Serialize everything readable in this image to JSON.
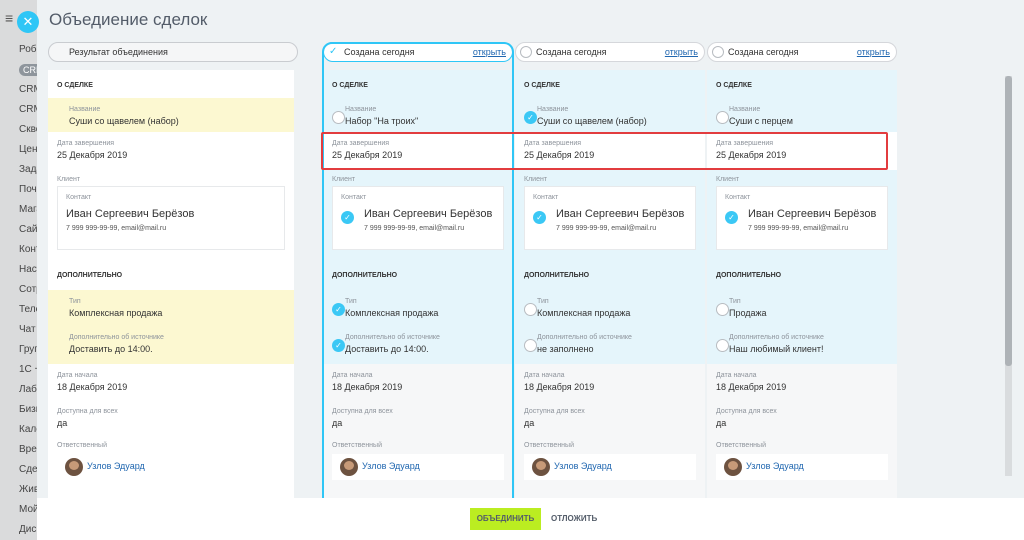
{
  "title": "Объедиение сделок",
  "sidebar": {
    "items": [
      "Робо",
      "CRM",
      "CRM",
      "CRM",
      "Скво",
      "Цен",
      "Зада",
      "Поч",
      "Мага",
      "Сайт",
      "Конт",
      "Наст",
      "Сотр",
      "Теле",
      "Чат",
      "Груп",
      "1С +",
      "Лаба",
      "Бизн",
      "Кале",
      "Врем",
      "Сдел",
      "Живо",
      "Мой",
      "Дисн"
    ]
  },
  "result_header": "Результат объединения",
  "sections": {
    "about": "О СДЕЛКЕ",
    "extra": "ДОПОЛНИТЕЛЬНО"
  },
  "labels": {
    "name": "Название",
    "close_date": "Дата завершения",
    "client": "Клиент",
    "contact": "Контакт",
    "type": "Тип",
    "source_info": "Дополнительно об источнике",
    "start_date": "Дата начала",
    "available": "Доступна для всех",
    "responsible": "Ответственный"
  },
  "result": {
    "name": "Суши со щавелем (набор)",
    "close_date": "25 Декабря 2019",
    "contact_name": "Иван Сергеевич Берёзов",
    "contact_phone": "7 999 999-99-99, email@mail.ru",
    "type": "Комплексная продажа",
    "source_info": "Доставить до 14:00.",
    "start_date": "18 Декабря 2019",
    "available": "да",
    "responsible": "Узлов Эдуард"
  },
  "columns": [
    {
      "header": "Создана сегодня",
      "open_label": "открыть",
      "name": "Набор \"На троих\"",
      "close_date": "25 Декабря 2019",
      "contact_name": "Иван Сергеевич Берёзов",
      "contact_phone": "7 999 999-99-99, email@mail.ru",
      "type": "Комплексная продажа",
      "source_info": "Доставить до 14:00.",
      "start_date": "18 Декабря 2019",
      "available": "да",
      "responsible": "Узлов Эдуард"
    },
    {
      "header": "Создана сегодня",
      "open_label": "открыть",
      "name": "Суши со щавелем (набор)",
      "close_date": "25 Декабря 2019",
      "contact_name": "Иван Сергеевич Берёзов",
      "contact_phone": "7 999 999-99-99, email@mail.ru",
      "type": "Комплексная продажа",
      "source_info": "не заполнено",
      "start_date": "18 Декабря 2019",
      "available": "да",
      "responsible": "Узлов Эдуард"
    },
    {
      "header": "Создана сегодня",
      "open_label": "открыть",
      "name": "Суши с перцем",
      "close_date": "25 Декабря 2019",
      "contact_name": "Иван Сергеевич Берёзов",
      "contact_phone": "7 999 999-99-99, email@mail.ru",
      "type": "Продажа",
      "source_info": "Наш любимый клиент!",
      "start_date": "18 Декабря 2019",
      "available": "да",
      "responsible": "Узлов Эдуард"
    }
  ],
  "footer": {
    "merge_label": "ОБЪЕДИНИТЬ",
    "postpone_label": "ОТЛОЖИТЬ"
  },
  "colors": {
    "accent": "#2fc6f6",
    "selected_bg": "#e5f5fb",
    "changed_bg": "#fcf8d1",
    "merge_button": "#bbed21",
    "highlight": "#e23c3f"
  },
  "icons": {
    "menu": "hamburger-icon",
    "close": "close-icon",
    "selected": "check-circle-icon",
    "unselected": "radio-empty-icon",
    "changed": "red-dot-icon"
  }
}
